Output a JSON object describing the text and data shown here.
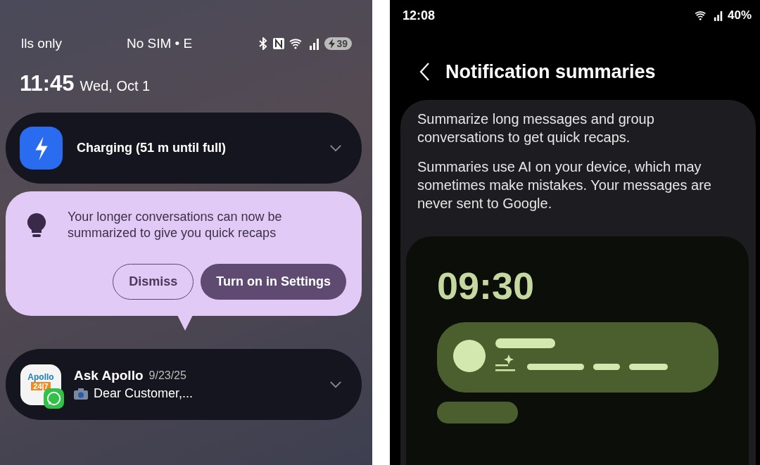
{
  "lock_screen": {
    "status_bar": {
      "carrier_left": "lls only",
      "carrier_center": "No SIM • E",
      "battery": "39"
    },
    "clock": {
      "time": "11:45",
      "date": "Wed, Oct 1"
    },
    "charging_notification": {
      "title": "Charging (51 m until full)",
      "expanded": false
    },
    "tip": {
      "message": "Your longer conversations can now be summarized to give you quick recaps",
      "buttons": [
        {
          "label": "Dismiss",
          "kind": "outlined"
        },
        {
          "label": "Turn on in Settings",
          "kind": "filled"
        }
      ]
    },
    "message_notification": {
      "app_logo_text": "Apollo",
      "app_logo_badge": "24|7",
      "title": "Ask Apollo",
      "time": "9/23/25",
      "preview": "Dear Customer,...",
      "expanded": false
    }
  },
  "settings_screen": {
    "status_bar": {
      "time": "12:08",
      "battery": "40%"
    },
    "title": "Notification summaries",
    "paragraphs": [
      "Summarize long messages and group conversations to get quick recaps.",
      "Summaries use AI on your device, which may sometimes make mistakes. Your messages are never sent to Google."
    ],
    "preview": {
      "time": "09:30"
    }
  }
}
